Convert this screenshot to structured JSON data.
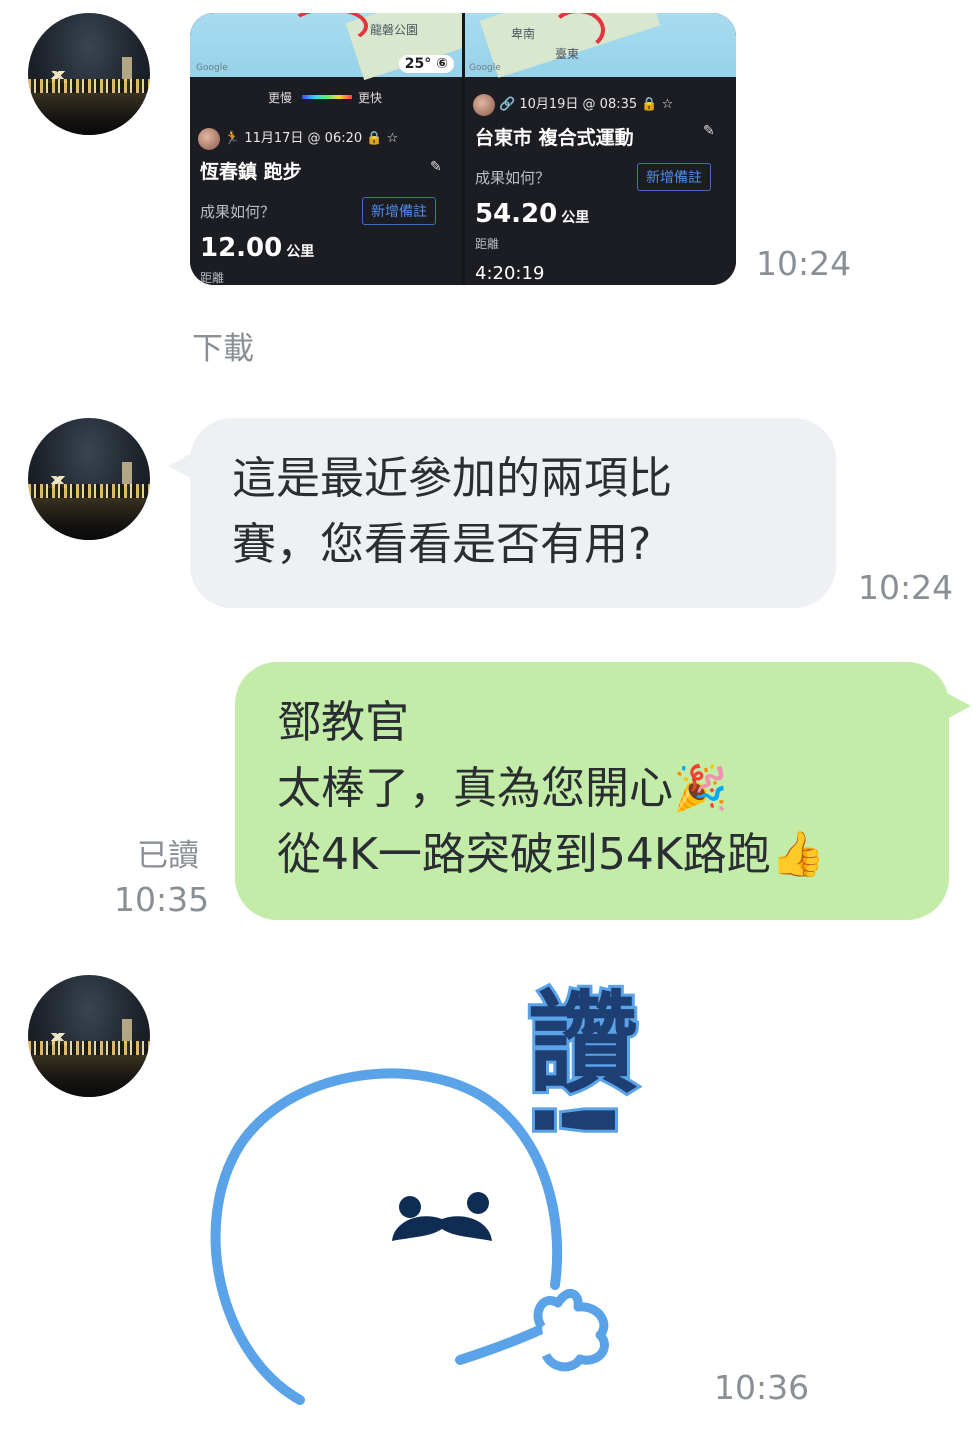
{
  "messages": {
    "m1": {
      "time": "10:24",
      "download_label": "下載",
      "cards": [
        {
          "map_label": "龍磐公園",
          "temp": "25° ⑥",
          "speed_slow": "更慢",
          "speed_fast": "更快",
          "meta": "11月17日 @ 06:20",
          "title": "恆春鎮 跑步",
          "prompt": "成果如何？",
          "add_note": "新增備註",
          "distance": "12.00",
          "unit": "公里",
          "distance_label": "距離"
        },
        {
          "map_label": "卑南",
          "map_label2": "臺東",
          "meta": "10月19日 @ 08:35",
          "title": "台東市 複合式運動",
          "prompt": "成果如何？",
          "add_note": "新增備註",
          "distance": "54.20",
          "unit": "公里",
          "distance_label": "距離",
          "duration": "4:20:19"
        }
      ]
    },
    "m2": {
      "lines": [
        "這是最近參加的兩項比",
        "賽，您看看是否有用?"
      ],
      "time": "10:24"
    },
    "m3": {
      "lines": [
        "鄧教官",
        "太棒了，真為您開心🎉",
        "從4K一路突破到54K路跑👍"
      ],
      "read_label": "已讀",
      "time": "10:35"
    },
    "m4": {
      "sticker_text": "讚!",
      "time": "10:36"
    }
  },
  "colors": {
    "incoming_bubble": "#eef0f3",
    "outgoing_bubble": "#c3eca9",
    "timestamp": "#8a8f96"
  }
}
